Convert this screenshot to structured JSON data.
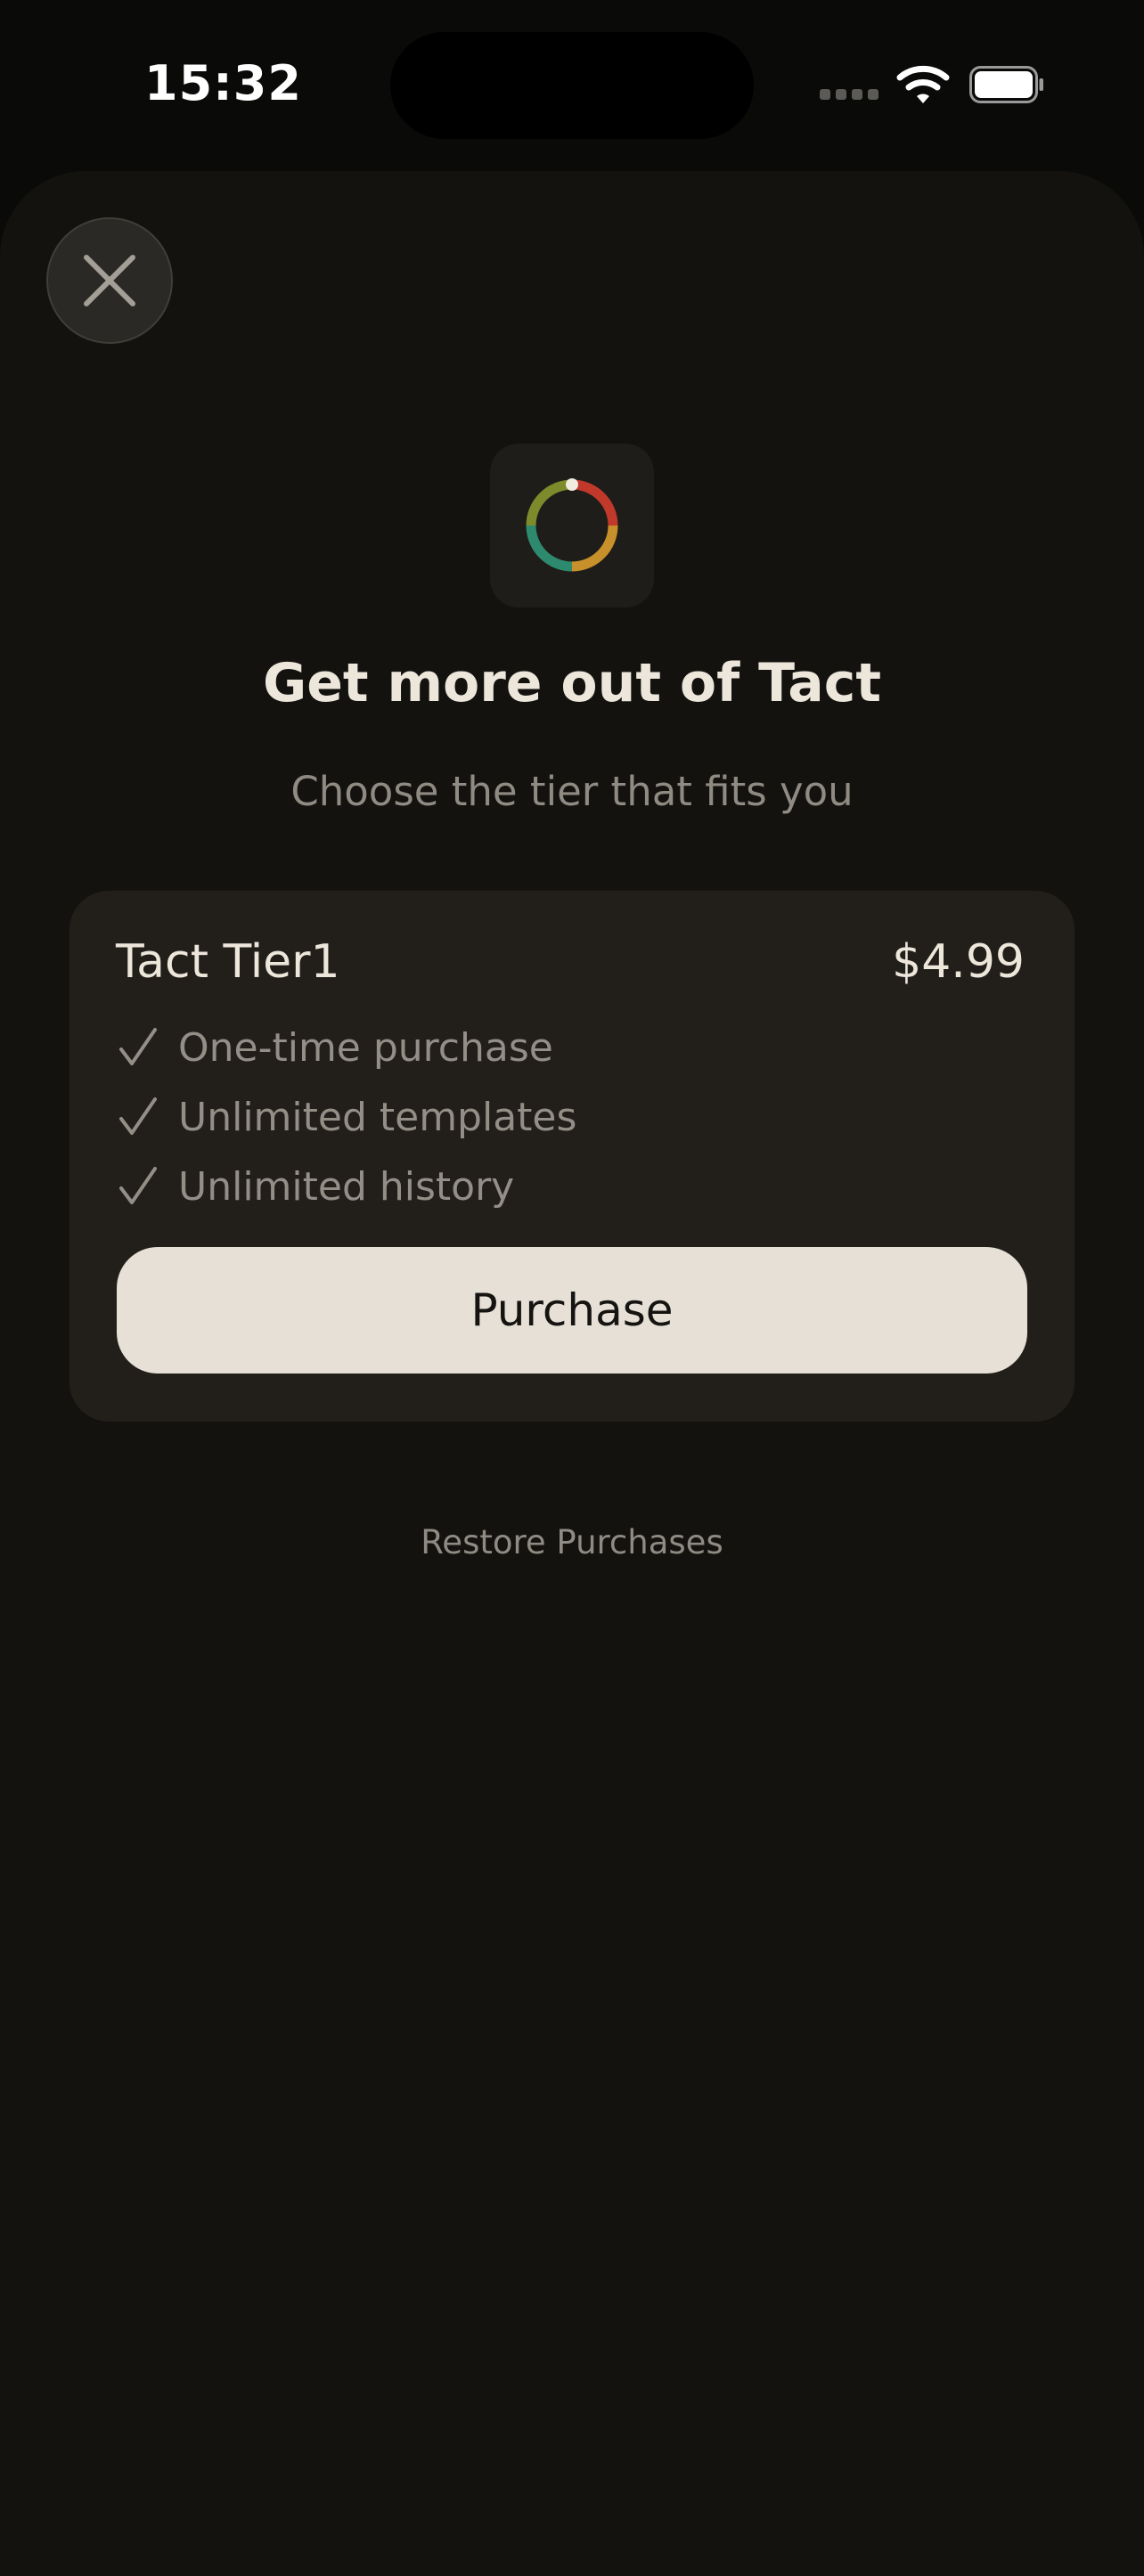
{
  "status_bar": {
    "time": "15:32",
    "icons": [
      "cellular-signal-icon",
      "wifi-icon",
      "battery-icon"
    ]
  },
  "paywall": {
    "close_icon": "close-icon",
    "app_icon": "tact-ring-icon",
    "title": "Get more out of Tact",
    "subtitle": "Choose the tier that fits you",
    "tier": {
      "name": "Tact Tier1",
      "price": "$4.99",
      "features": [
        "One-time purchase",
        "Unlimited templates",
        "Unlimited history"
      ],
      "purchase_label": "Purchase"
    },
    "restore_label": "Restore Purchases"
  },
  "colors": {
    "background": "#0a0a09",
    "sheet": "#13120f",
    "card": "#221f1b",
    "button": "#e7e0d6",
    "text_primary": "#ece6db",
    "text_secondary": "#8f8a82"
  }
}
